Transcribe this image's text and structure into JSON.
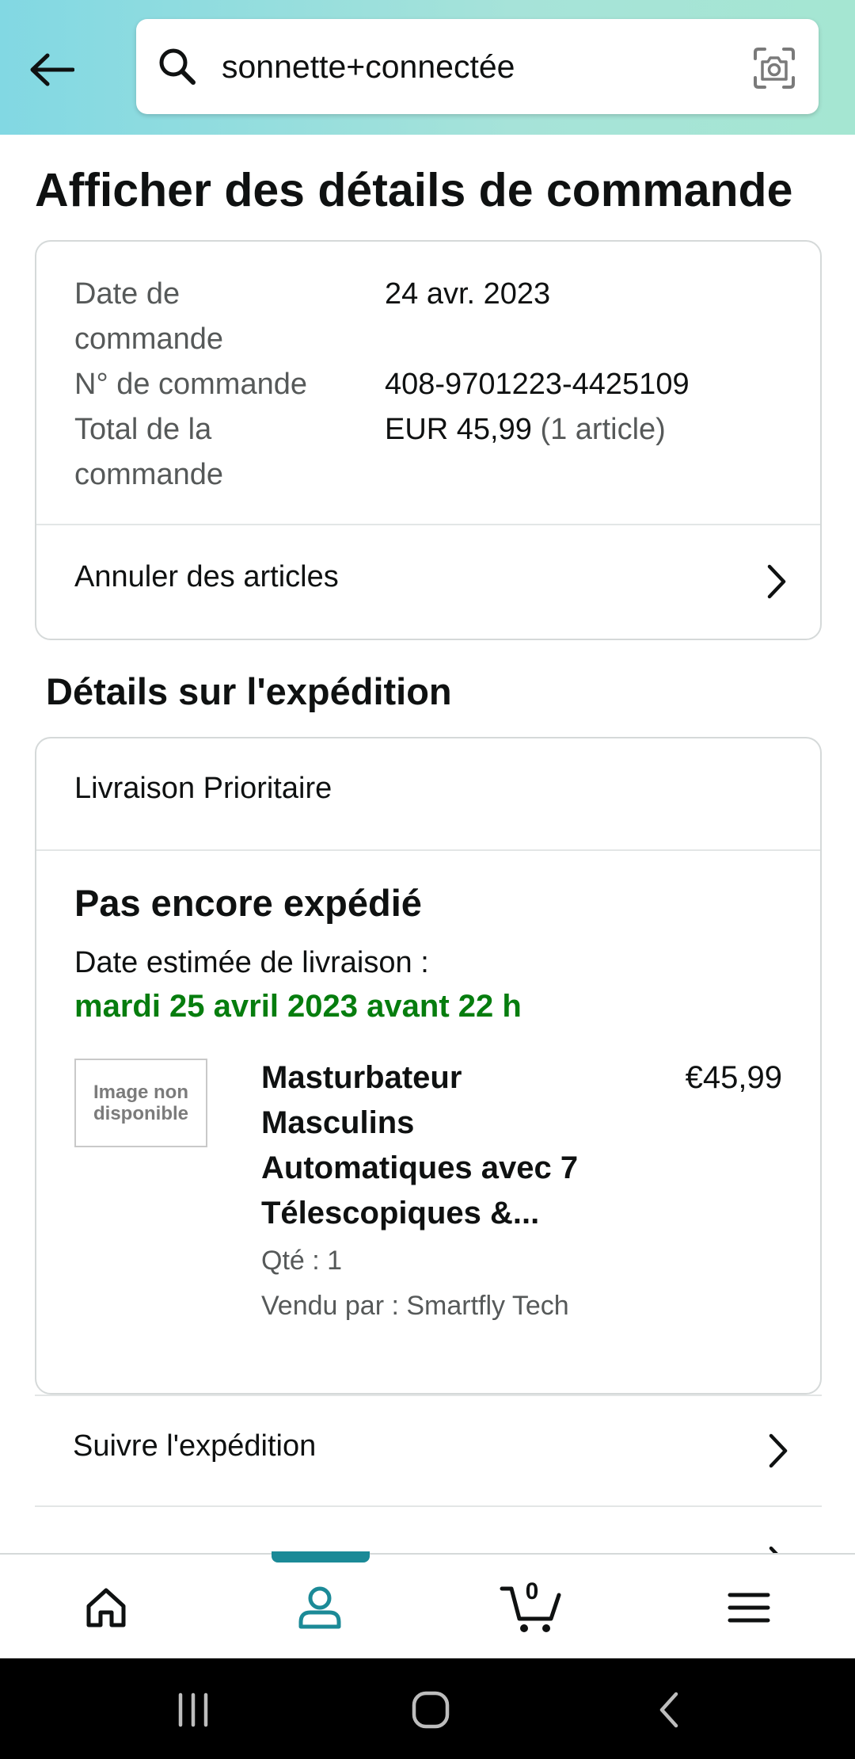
{
  "search": {
    "query": "sonnette+connectée"
  },
  "page": {
    "title": "Afficher des détails de commande"
  },
  "order_summary": {
    "rows": [
      {
        "label": "Date de commande",
        "value": "24 avr. 2023"
      },
      {
        "label": "N° de commande",
        "value": "408-9701223-4425109"
      },
      {
        "label": "Total de la commande",
        "value": "EUR 45,99",
        "value_note": "(1 article)"
      }
    ],
    "cancel_label": "Annuler des articles"
  },
  "shipment": {
    "section_title": "Détails sur l'expédition",
    "method": "Livraison Prioritaire",
    "status": "Pas encore expédié",
    "estimated_label": "Date estimée de livraison :",
    "estimated_date": "mardi 25 avril 2023 avant 22 h",
    "item": {
      "image_placeholder": "Image non disponible",
      "title": "Masturbateur Masculins Automatiques avec 7 Télescopiques &...",
      "price": "€45,99",
      "qty": "Qté : 1",
      "seller": "Vendu par : Smartfly Tech"
    },
    "track_label": "Suivre l'expédition"
  },
  "bottom_nav": {
    "active": "account",
    "items": [
      "home-icon",
      "account-icon",
      "cart-icon",
      "menu-icon"
    ],
    "cart_count": "0"
  },
  "colors": {
    "accent": "#1b8a97",
    "delivery_green": "#067d0e",
    "header_gradient_start": "#82d8e3",
    "header_gradient_end": "#a5e6d2"
  }
}
